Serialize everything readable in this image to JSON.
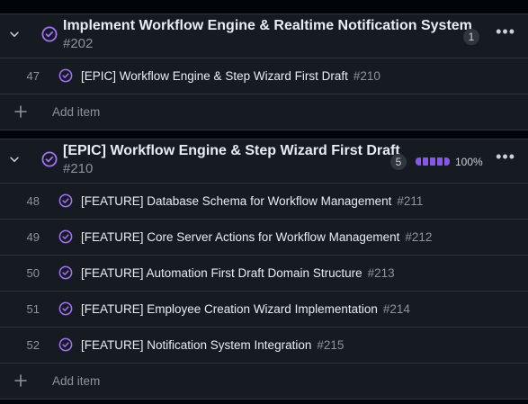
{
  "colors": {
    "accent": "#8957e5",
    "done_icon": "#a371f7",
    "background": "#010409",
    "group_bg": "#161b22"
  },
  "groups": [
    {
      "title": "Implement Workflow Engine & Realtime Notification System",
      "number": "#202",
      "count": "1",
      "items": [
        {
          "num": "47",
          "title": "[EPIC] Workflow Engine & Step Wizard First Draft",
          "ref": "#210"
        }
      ],
      "add_label": "Add item"
    },
    {
      "title": "[EPIC] Workflow Engine & Step Wizard First Draft",
      "number": "#210",
      "count": "5",
      "progress": "100%",
      "progress_value": 1.0,
      "items": [
        {
          "num": "48",
          "title": "[FEATURE] Database Schema for Workflow Management",
          "ref": "#211"
        },
        {
          "num": "49",
          "title": "[FEATURE] Core Server Actions for Workflow Management",
          "ref": "#212"
        },
        {
          "num": "50",
          "title": "[FEATURE] Automation First Draft Domain Structure",
          "ref": "#213"
        },
        {
          "num": "51",
          "title": "[FEATURE] Employee Creation Wizard Implementation",
          "ref": "#214"
        },
        {
          "num": "52",
          "title": "[FEATURE] Notification System Integration",
          "ref": "#215"
        }
      ],
      "add_label": "Add item"
    }
  ],
  "icons": {
    "collapse": "chevron-down-icon",
    "status": "issue-closed-icon",
    "menu": "kebab-menu-icon",
    "add": "plus-icon"
  }
}
